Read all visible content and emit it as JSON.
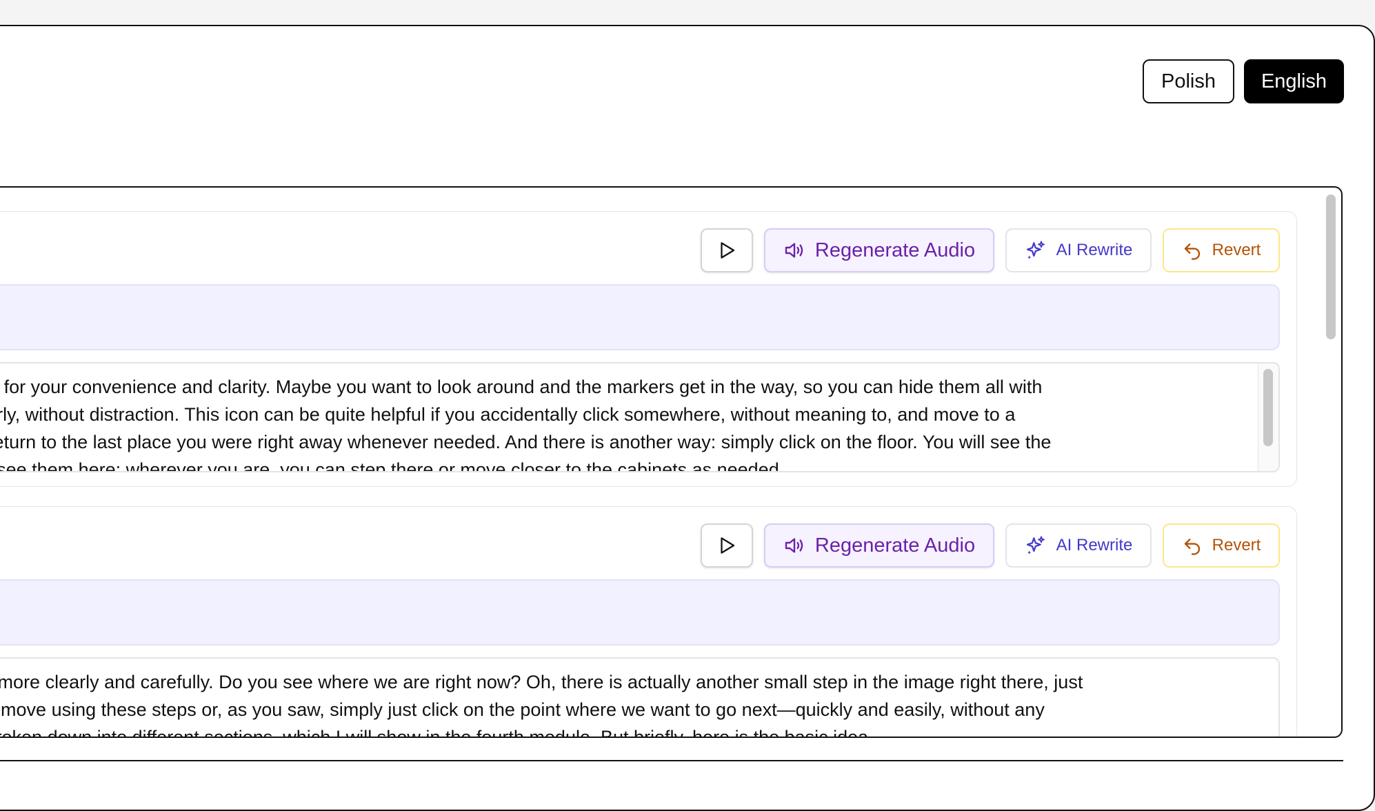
{
  "language_switch": {
    "options": [
      "Polish",
      "English"
    ],
    "selected": "English",
    "polish_label": "Polish",
    "english_label": "English"
  },
  "toolbar": {
    "play_icon": "play-icon",
    "regenerate_label": "Regenerate Audio",
    "regenerate_icon": "speaker-icon",
    "rewrite_label": "AI Rewrite",
    "rewrite_icon": "sparkles-icon",
    "revert_label": "Revert",
    "revert_icon": "undo-icon"
  },
  "segments": [
    {
      "lines": [
        "ou need, for your convenience and clarity. Maybe you want to look around and the markers get in the way, so you can hide them all with",
        " and clearly, without distraction. This icon can be quite helpful if you accidentally click somewhere, without meaning to, and move to a",
        "ou can return to the last place you were right away whenever needed. And there is another way: simply click on the floor. You will see the",
        "you can see them here: wherever you are, you can step there or move closer to the cabinets as needed."
      ]
    },
    {
      "lines": [
        "s better, more clearly and carefully. Do you see where we are right now? Oh, there is actually another small step in the image right there, just",
        "t we can move using these steps or, as you saw, simply just click on the point where we want to go next—quickly and easily, without any",
        " This is broken down into different sections, which I will show in the fourth module. But briefly, here is the basic idea."
      ]
    }
  ],
  "colors": {
    "accent_purple": "#6b21a8",
    "rewrite_indigo": "#4338ca",
    "revert_amber": "#b45309"
  }
}
